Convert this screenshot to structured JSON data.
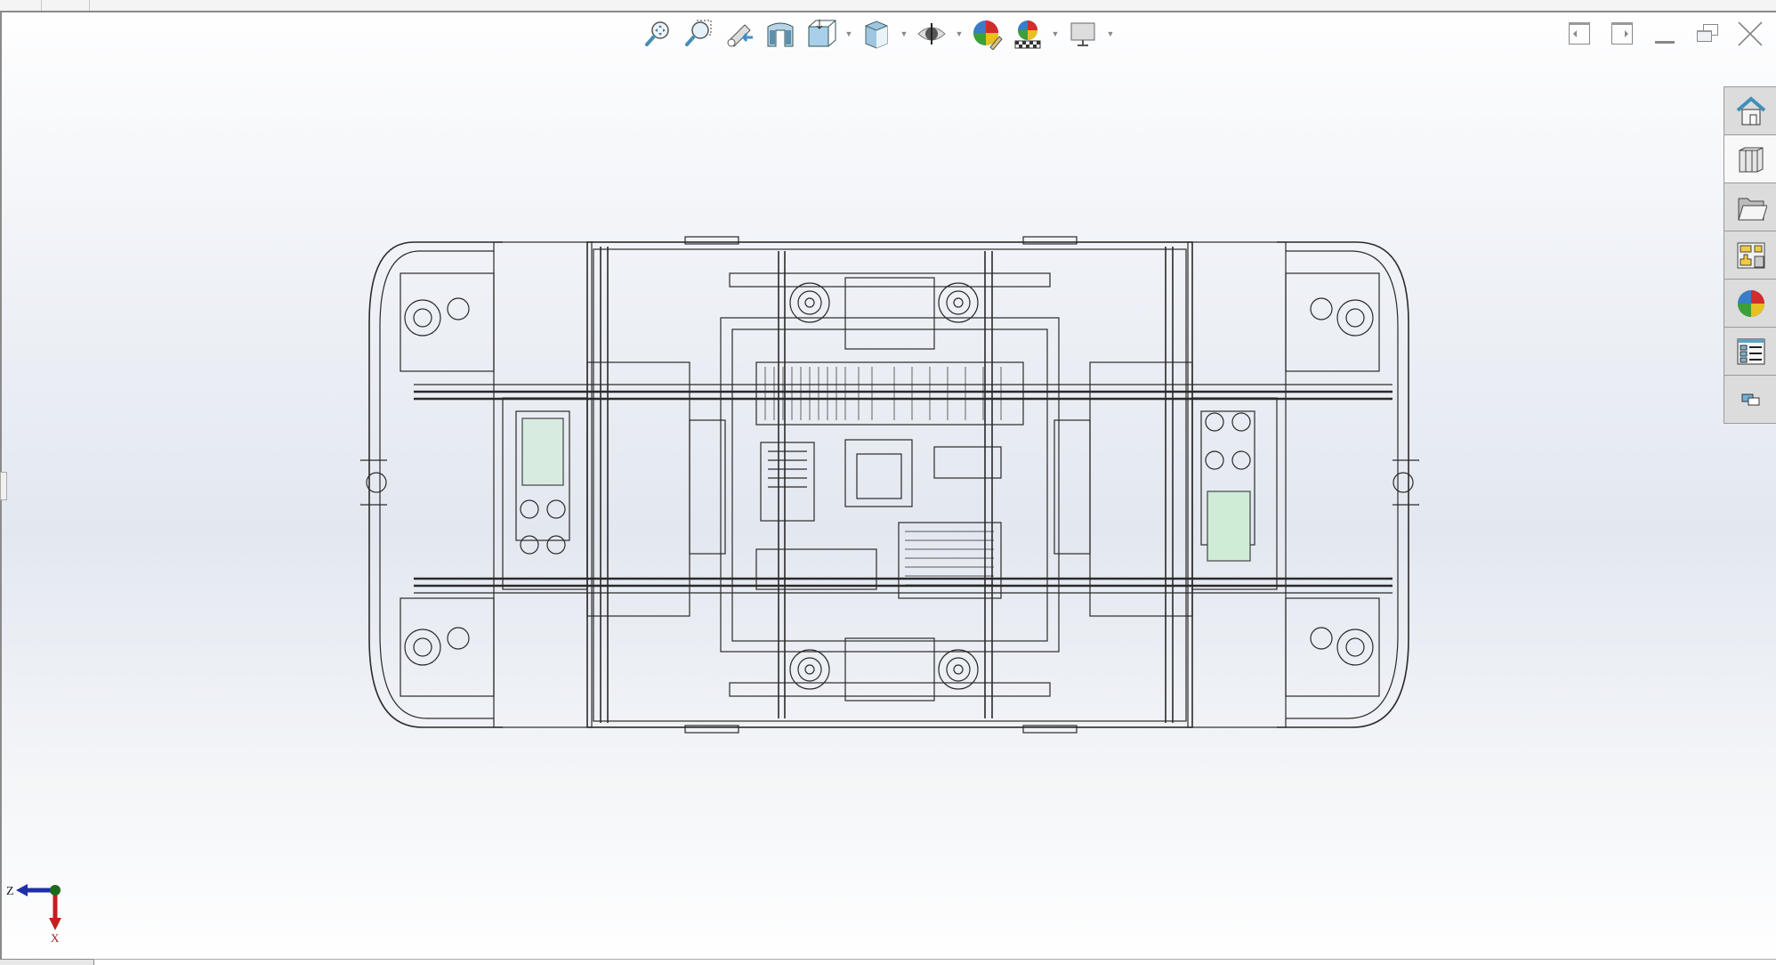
{
  "view_toolbar": {
    "items": [
      {
        "icon": "zoom-to-fit-icon",
        "has_dropdown": false
      },
      {
        "icon": "zoom-to-area-icon",
        "has_dropdown": false
      },
      {
        "icon": "previous-view-icon",
        "has_dropdown": false
      },
      {
        "icon": "section-view-icon",
        "has_dropdown": false
      },
      {
        "icon": "view-orientation-icon",
        "has_dropdown": true
      },
      {
        "icon": "display-style-icon",
        "has_dropdown": true
      },
      {
        "icon": "hide-show-items-icon",
        "has_dropdown": true
      },
      {
        "icon": "edit-appearance-icon",
        "has_dropdown": false
      },
      {
        "icon": "apply-scene-icon",
        "has_dropdown": true
      },
      {
        "icon": "view-settings-icon",
        "has_dropdown": true
      }
    ]
  },
  "window_controls": [
    "tile-left-icon",
    "tile-right-icon",
    "minimize-icon",
    "restore-icon",
    "close-icon"
  ],
  "task_pane": {
    "items": [
      {
        "icon": "home-icon",
        "active": false
      },
      {
        "icon": "design-library-icon",
        "active": true
      },
      {
        "icon": "file-explorer-icon",
        "active": false
      },
      {
        "icon": "view-palette-icon",
        "active": false
      },
      {
        "icon": "appearances-icon",
        "active": false
      },
      {
        "icon": "custom-properties-icon",
        "active": false
      },
      {
        "icon": "forum-icon",
        "active": false
      }
    ]
  },
  "triad": {
    "horizontal_axis": "Z",
    "vertical_axis": "X",
    "colors": {
      "z": "#1f2fa8",
      "x": "#c42020",
      "origin": "#1c6b1c"
    }
  },
  "viewport": {
    "display_style": "wireframe",
    "line_color": "#2a2a2a"
  }
}
